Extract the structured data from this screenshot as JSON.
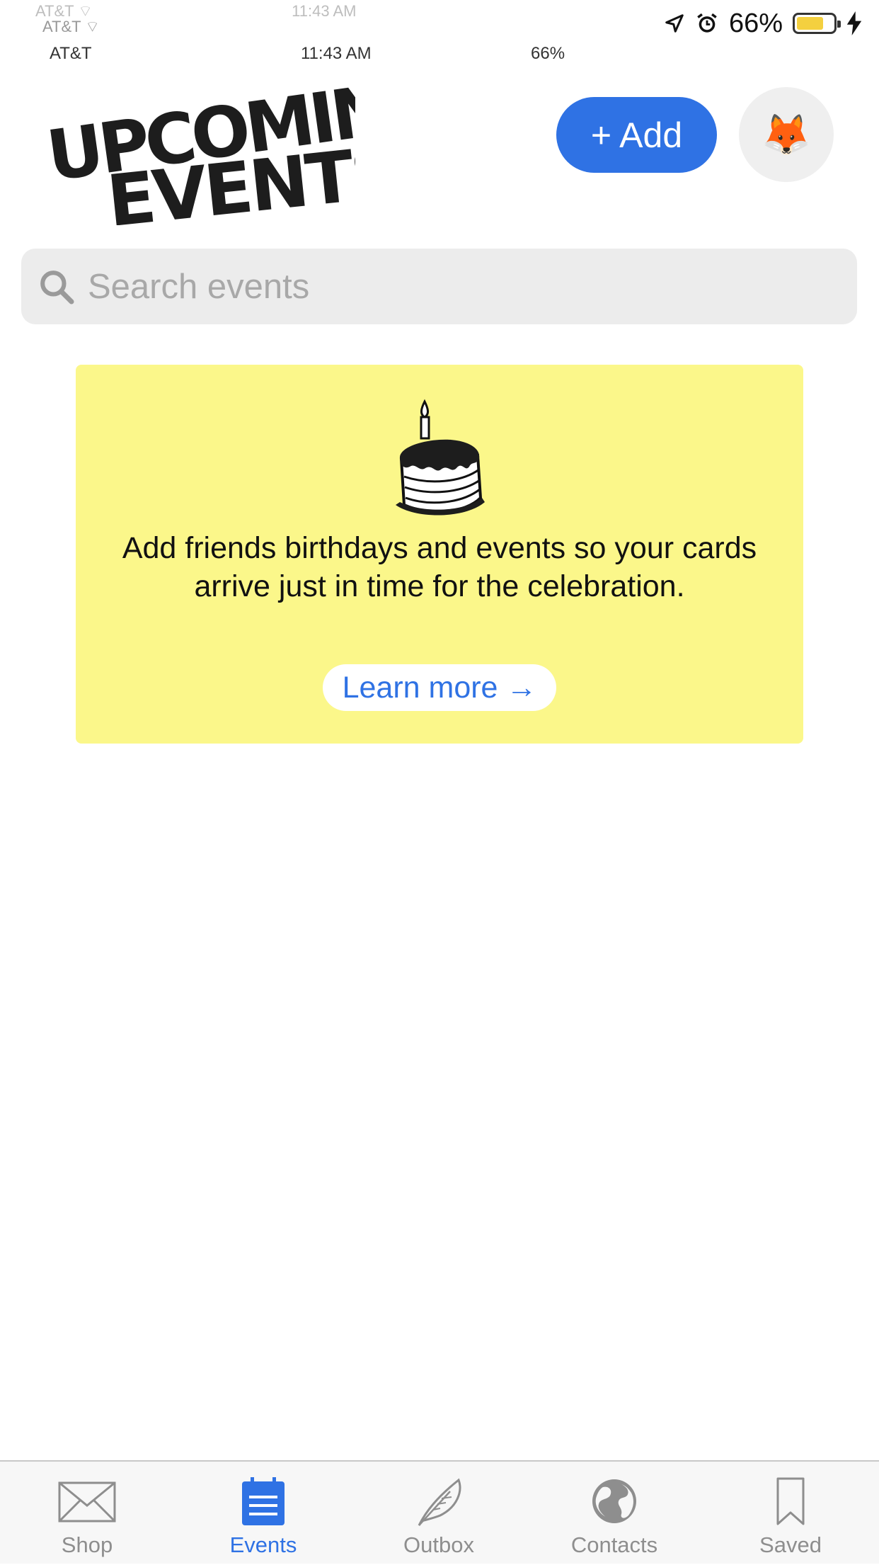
{
  "status_bar": {
    "carrier": "AT&T",
    "time": "11:43 AM",
    "battery_percent": "66%",
    "battery_level": 0.66,
    "icons": [
      "signal-icon",
      "wifi-icon",
      "location-icon",
      "alarm-icon",
      "battery-icon",
      "charging-icon"
    ]
  },
  "header": {
    "logo_text_line1": "UPCOMING",
    "logo_text_line2": "EVENTS",
    "add_label": "+ Add",
    "avatar_emoji": "🦊"
  },
  "search": {
    "placeholder": "Search events"
  },
  "promo": {
    "message": "Add friends birthdays and events so your cards arrive just in time for the celebration.",
    "learn_more_label": "Learn more →",
    "background_color": "#fbf78a"
  },
  "tab_bar": {
    "tabs": [
      {
        "label": "Shop",
        "icon": "envelope-icon",
        "active": false
      },
      {
        "label": "Events",
        "icon": "calendar-icon",
        "active": true
      },
      {
        "label": "Outbox",
        "icon": "feather-icon",
        "active": false
      },
      {
        "label": "Contacts",
        "icon": "globe-icon",
        "active": false
      },
      {
        "label": "Saved",
        "icon": "bookmark-icon",
        "active": false
      }
    ]
  },
  "colors": {
    "accent": "#2f72e4",
    "inactive": "#8e8e8e"
  }
}
